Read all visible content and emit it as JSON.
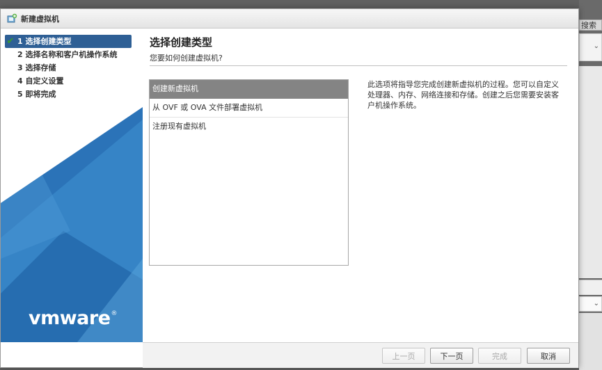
{
  "window": {
    "title": "新建虚拟机"
  },
  "background": {
    "search_label": "搜索"
  },
  "sidebar": {
    "steps": [
      {
        "label": "1 选择创建类型",
        "active": true,
        "completed": true
      },
      {
        "label": "2 选择名称和客户机操作系统",
        "active": false,
        "completed": false
      },
      {
        "label": "3 选择存储",
        "active": false,
        "completed": false
      },
      {
        "label": "4 自定义设置",
        "active": false,
        "completed": false
      },
      {
        "label": "5 即将完成",
        "active": false,
        "completed": false
      }
    ],
    "check_glyph": "✔",
    "logo_text": "vmware",
    "logo_mark": "®"
  },
  "main": {
    "title": "选择创建类型",
    "subtitle": "您要如何创建虚拟机?",
    "options": [
      {
        "label": "创建新虚拟机",
        "selected": true
      },
      {
        "label": "从 OVF 或 OVA 文件部署虚拟机",
        "selected": false
      },
      {
        "label": "注册现有虚拟机",
        "selected": false
      }
    ],
    "description": "此选项将指导您完成创建新虚拟机的过程。您可以自定义处理器、内存、网络连接和存储。创建之后您需要安装客户机操作系统。"
  },
  "footer": {
    "prev_label": "上一页",
    "next_label": "下一页",
    "finish_label": "完成",
    "cancel_label": "取消"
  },
  "colors": {
    "active_step_bg": "#2e5f95",
    "selected_option_bg": "#848484",
    "brand_blue": "#2b73b8",
    "check_green": "#3a9c2e"
  },
  "icons": {
    "title": "new-vm-icon",
    "check": "check-icon",
    "chevron": "chevron-down-icon"
  }
}
